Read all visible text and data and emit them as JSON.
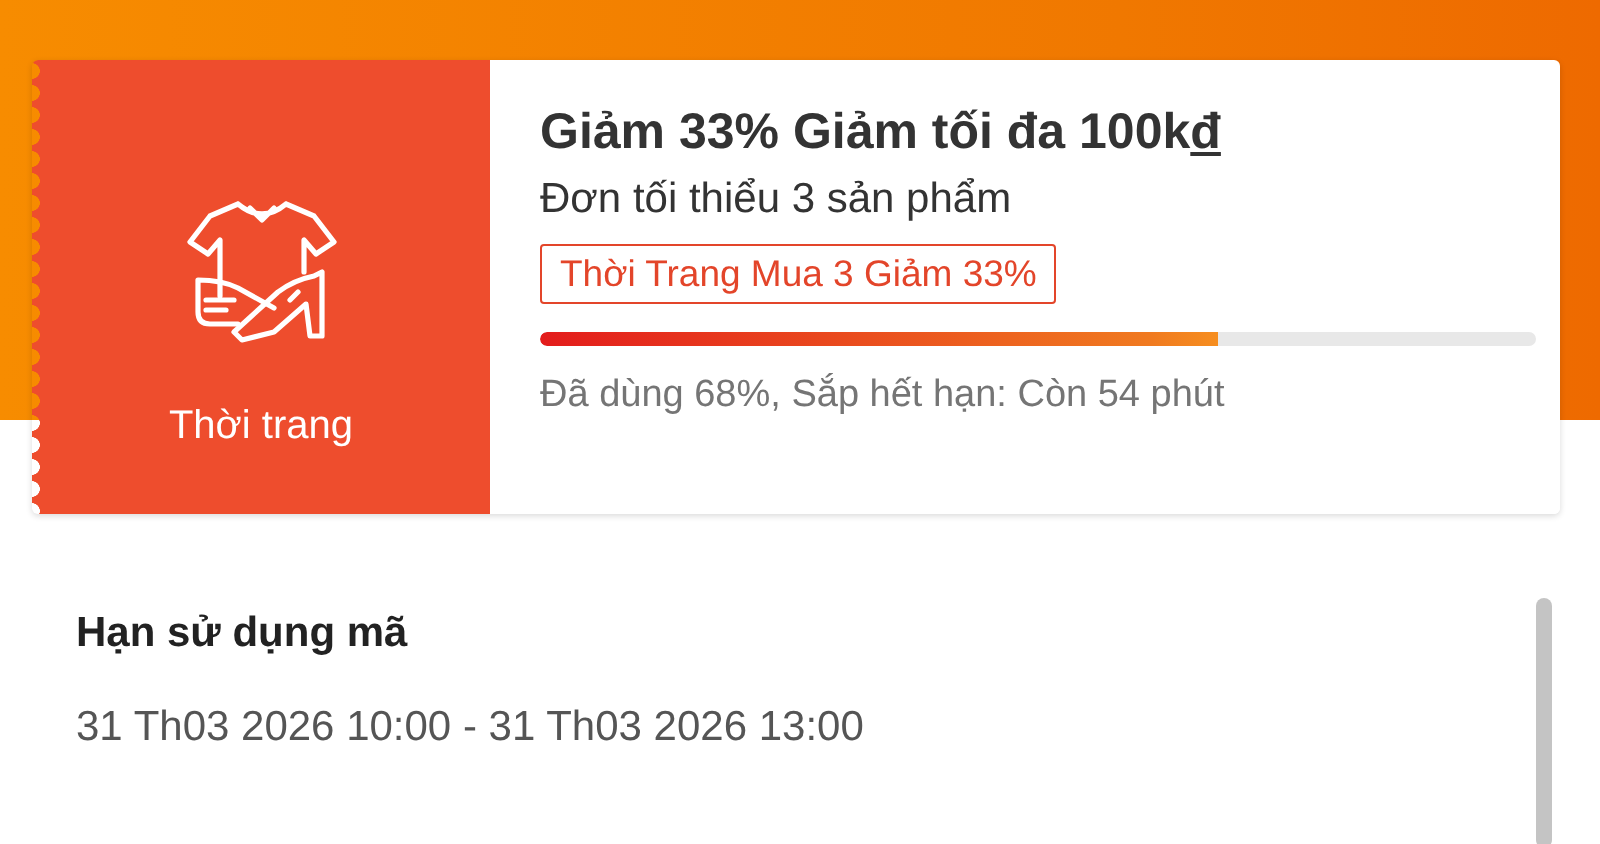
{
  "voucher": {
    "category": "Thời trang",
    "title": "Giảm 33% Giảm tối đa 100k",
    "currency": "đ",
    "condition": "Đơn tối thiểu 3 sản phẩm",
    "tag": "Thời Trang Mua 3 Giảm 33%",
    "usage": {
      "level": 0.68
    },
    "status": "Đã dùng 68%, Sắp hết hạn: Còn 54 phút"
  },
  "validity": {
    "heading": "Hạn sử dụng mã",
    "period": "31 Th03 2026 10:00 - 31 Th03 2026 13:00"
  }
}
